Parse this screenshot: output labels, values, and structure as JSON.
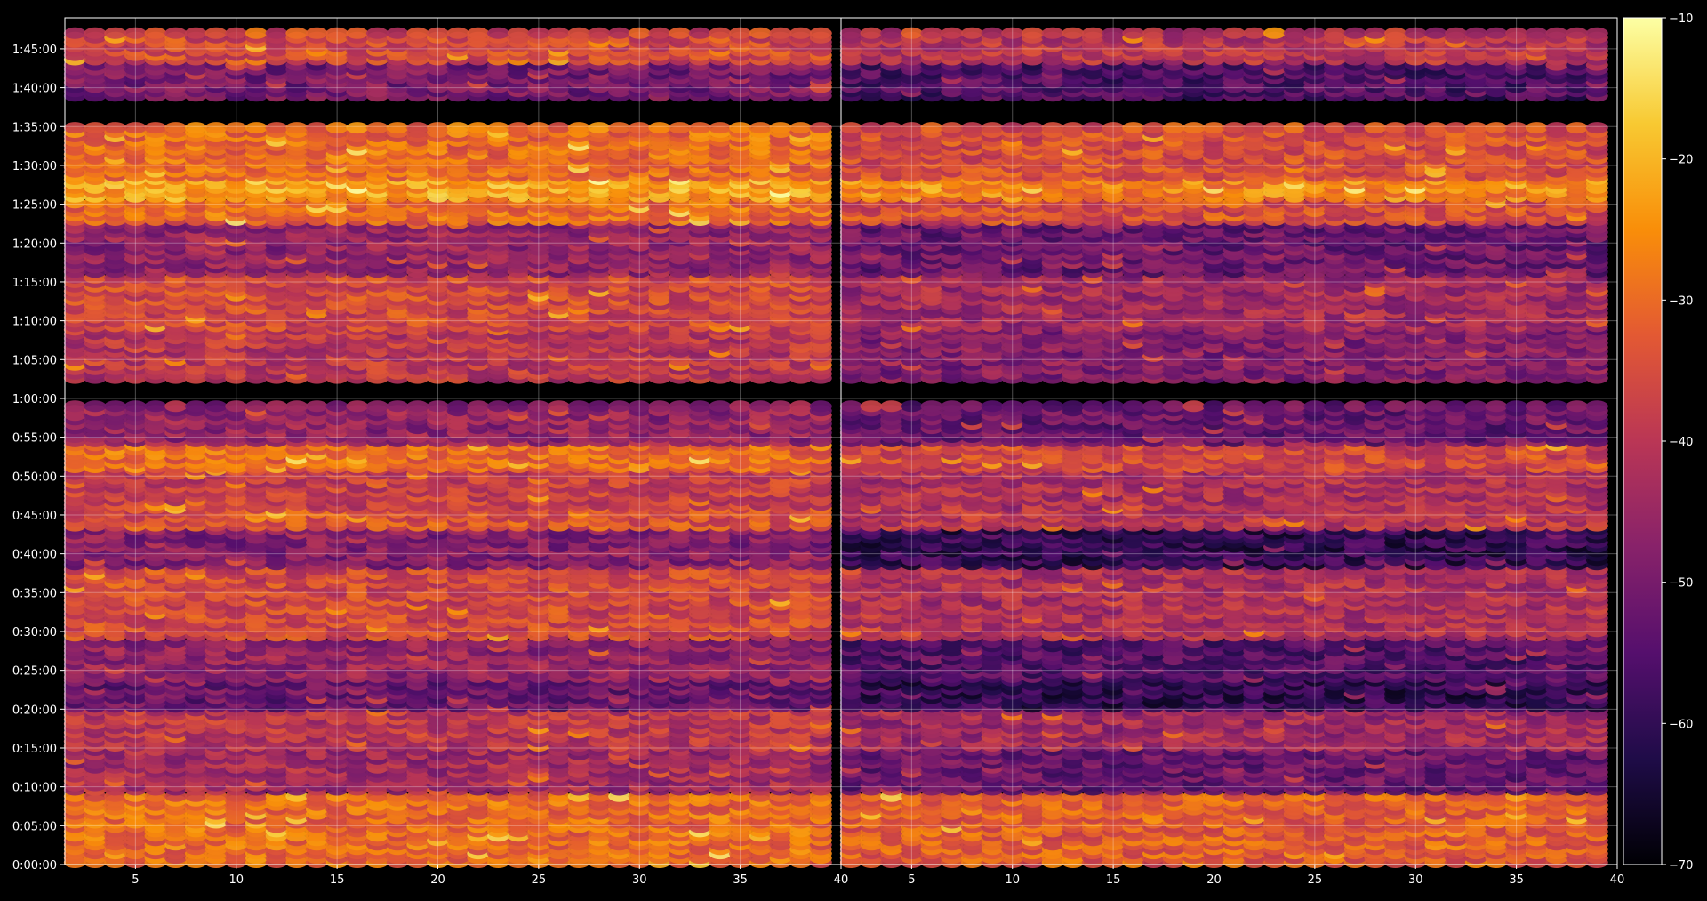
{
  "chart_data": {
    "type": "heatmap",
    "title": "",
    "xlabel": "",
    "ylabel": "",
    "colormap": "inferno",
    "background": "#000000",
    "grid": true,
    "panels": [
      {
        "xlim": [
          1.5,
          40
        ],
        "x_ticks": [
          5,
          10,
          15,
          20,
          25,
          30,
          35,
          40
        ],
        "x_tick_labels": [
          "5",
          "10",
          "15",
          "20",
          "25",
          "30",
          "35",
          "40"
        ]
      },
      {
        "xlim": [
          1.5,
          40
        ],
        "x_ticks": [
          5,
          10,
          15,
          20,
          25,
          30,
          35,
          40
        ],
        "x_tick_labels": [
          "5",
          "10",
          "15",
          "20",
          "25",
          "30",
          "35",
          "40"
        ]
      }
    ],
    "ylim_seconds": [
      0,
      6540
    ],
    "y_ticks_seconds": [
      0,
      300,
      600,
      900,
      1200,
      1500,
      1800,
      2100,
      2400,
      2700,
      3000,
      3300,
      3600,
      3900,
      4200,
      4500,
      4800,
      5100,
      5400,
      5700,
      6000,
      6300
    ],
    "y_tick_labels": [
      "0:00:00",
      "0:05:00",
      "0:10:00",
      "0:15:00",
      "0:20:00",
      "0:25:00",
      "0:30:00",
      "0:35:00",
      "0:40:00",
      "0:45:00",
      "0:50:00",
      "0:55:00",
      "1:00:00",
      "1:05:00",
      "1:10:00",
      "1:15:00",
      "1:20:00",
      "1:25:00",
      "1:30:00",
      "1:35:00",
      "1:40:00",
      "1:45:00"
    ],
    "colorbar": {
      "range": [
        -70,
        -10
      ],
      "ticks": [
        -70,
        -60,
        -50,
        -40,
        -30,
        -20,
        -10
      ],
      "tick_labels": [
        "−70",
        "−60",
        "−50",
        "−40",
        "−30",
        "−20",
        "−10"
      ]
    },
    "rows": [
      {
        "t_start": 0,
        "t_end": 560,
        "level": -30,
        "level_right": -32
      },
      {
        "t_start": 560,
        "t_end": 900,
        "level": -44,
        "level_right": -52
      },
      {
        "t_start": 900,
        "t_end": 1200,
        "level": -40,
        "level_right": -44
      },
      {
        "t_start": 1200,
        "t_end": 1430,
        "level": -52,
        "level_right": -60
      },
      {
        "t_start": 1430,
        "t_end": 1750,
        "level": -46,
        "level_right": -55
      },
      {
        "t_start": 1750,
        "t_end": 2300,
        "level": -36,
        "level_right": -42
      },
      {
        "t_start": 2300,
        "t_end": 2600,
        "level": -48,
        "level_right": -60
      },
      {
        "t_start": 2600,
        "t_end": 2760,
        "level": -34,
        "level_right": -40
      },
      {
        "t_start": 2760,
        "t_end": 3050,
        "level": -38,
        "level_right": -42
      },
      {
        "t_start": 3050,
        "t_end": 3250,
        "level": -30,
        "level_right": -36
      },
      {
        "t_start": 3250,
        "t_end": 3540,
        "level": -46,
        "level_right": -52
      },
      {
        "t_start": 3740,
        "t_end": 4140,
        "level": -40,
        "level_right": -48
      },
      {
        "t_start": 4140,
        "t_end": 4560,
        "level": -36,
        "level_right": -44
      },
      {
        "t_start": 4560,
        "t_end": 4960,
        "level": -46,
        "level_right": -52
      },
      {
        "t_start": 4960,
        "t_end": 5140,
        "level": -30,
        "level_right": -35
      },
      {
        "t_start": 5140,
        "t_end": 5300,
        "level": -22,
        "level_right": -26
      },
      {
        "t_start": 5300,
        "t_end": 5720,
        "level": -30,
        "level_right": -35
      },
      {
        "t_start": 5920,
        "t_end": 6200,
        "level": -50,
        "level_right": -56
      },
      {
        "t_start": 6200,
        "t_end": 6440,
        "level": -36,
        "level_right": -40
      }
    ]
  }
}
